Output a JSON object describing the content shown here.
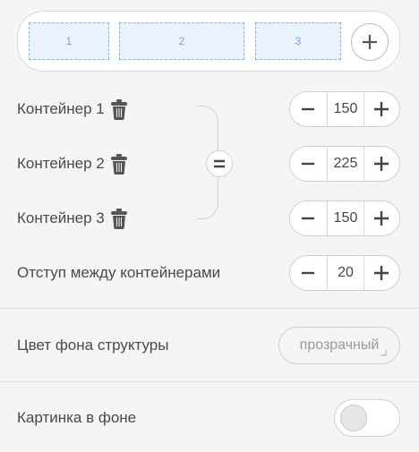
{
  "preview": {
    "cells": [
      "1",
      "2",
      "3"
    ]
  },
  "containers": [
    {
      "label": "Контейнер 1",
      "value": "150"
    },
    {
      "label": "Контейнер 2",
      "value": "225"
    },
    {
      "label": "Контейнер 3",
      "value": "150"
    }
  ],
  "gap": {
    "label": "Отступ между контейнерами",
    "value": "20"
  },
  "background_color": {
    "label": "Цвет фона структуры",
    "value": "прозрачный"
  },
  "background_image": {
    "label": "Картинка в фоне",
    "enabled": false
  },
  "colors": {
    "accent_dashed": "#7eb5e8",
    "cell_fill": "#eaf3fd",
    "icon": "#555555"
  }
}
